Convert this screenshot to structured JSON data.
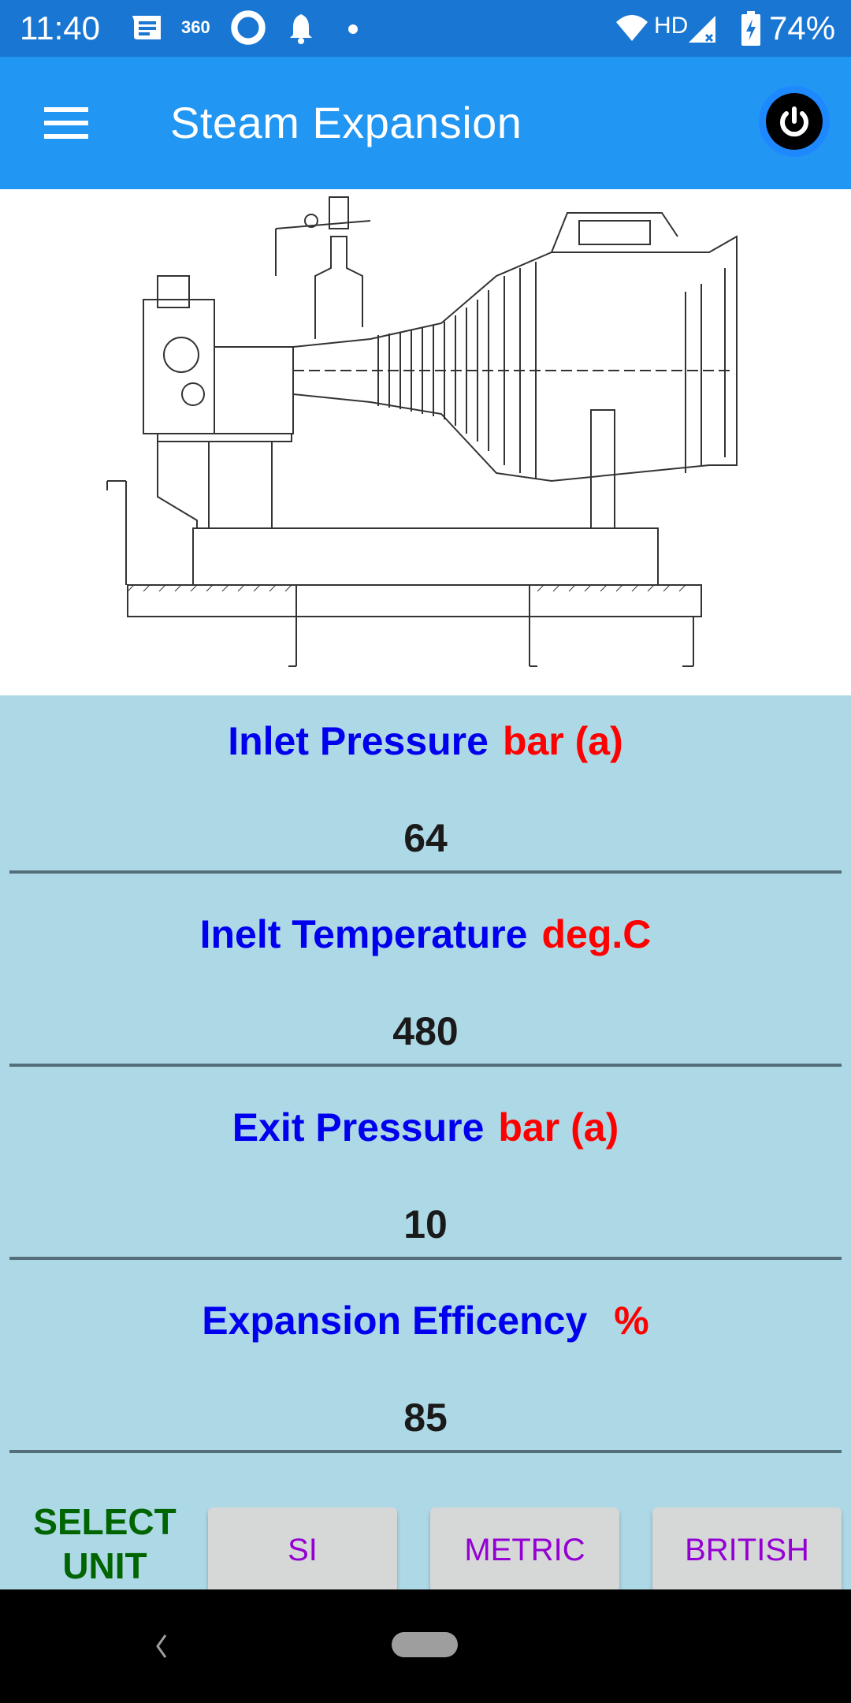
{
  "status_bar": {
    "time": "11:40",
    "notification_icons": [
      "messages-icon",
      "360-icon",
      "ring-app-icon",
      "bell-icon",
      "dot-icon"
    ],
    "notif_360_label": "360",
    "wifi_label": "HD",
    "battery_percent": "74%"
  },
  "app_bar": {
    "title": "Steam Expansion",
    "menu_icon": "hamburger-menu-icon",
    "power_icon": "power-icon"
  },
  "image": {
    "description": "Steam turbine cross-section drawing"
  },
  "form": {
    "fields": [
      {
        "label": "Inlet Pressure",
        "unit": "bar (a)",
        "value": "64"
      },
      {
        "label": "Inelt Temperature",
        "unit": "deg.C",
        "value": "480"
      },
      {
        "label": "Exit Pressure",
        "unit": "bar (a)",
        "value": "10"
      },
      {
        "label": "Expansion Efficency",
        "unit": "%",
        "value": "85"
      }
    ]
  },
  "unit_selector": {
    "label_line1": "SELECT",
    "label_line2": "UNIT",
    "buttons": [
      {
        "label": "SI"
      },
      {
        "label": "METRIC"
      },
      {
        "label": "BRITISH"
      }
    ]
  },
  "colors": {
    "status_bar": "#1976d2",
    "app_bar": "#2196f3",
    "form_bg": "#add8e6",
    "field_label": "#0000ee",
    "field_unit": "#ff0000",
    "select_label": "#006400",
    "button_text": "#9400d3"
  }
}
